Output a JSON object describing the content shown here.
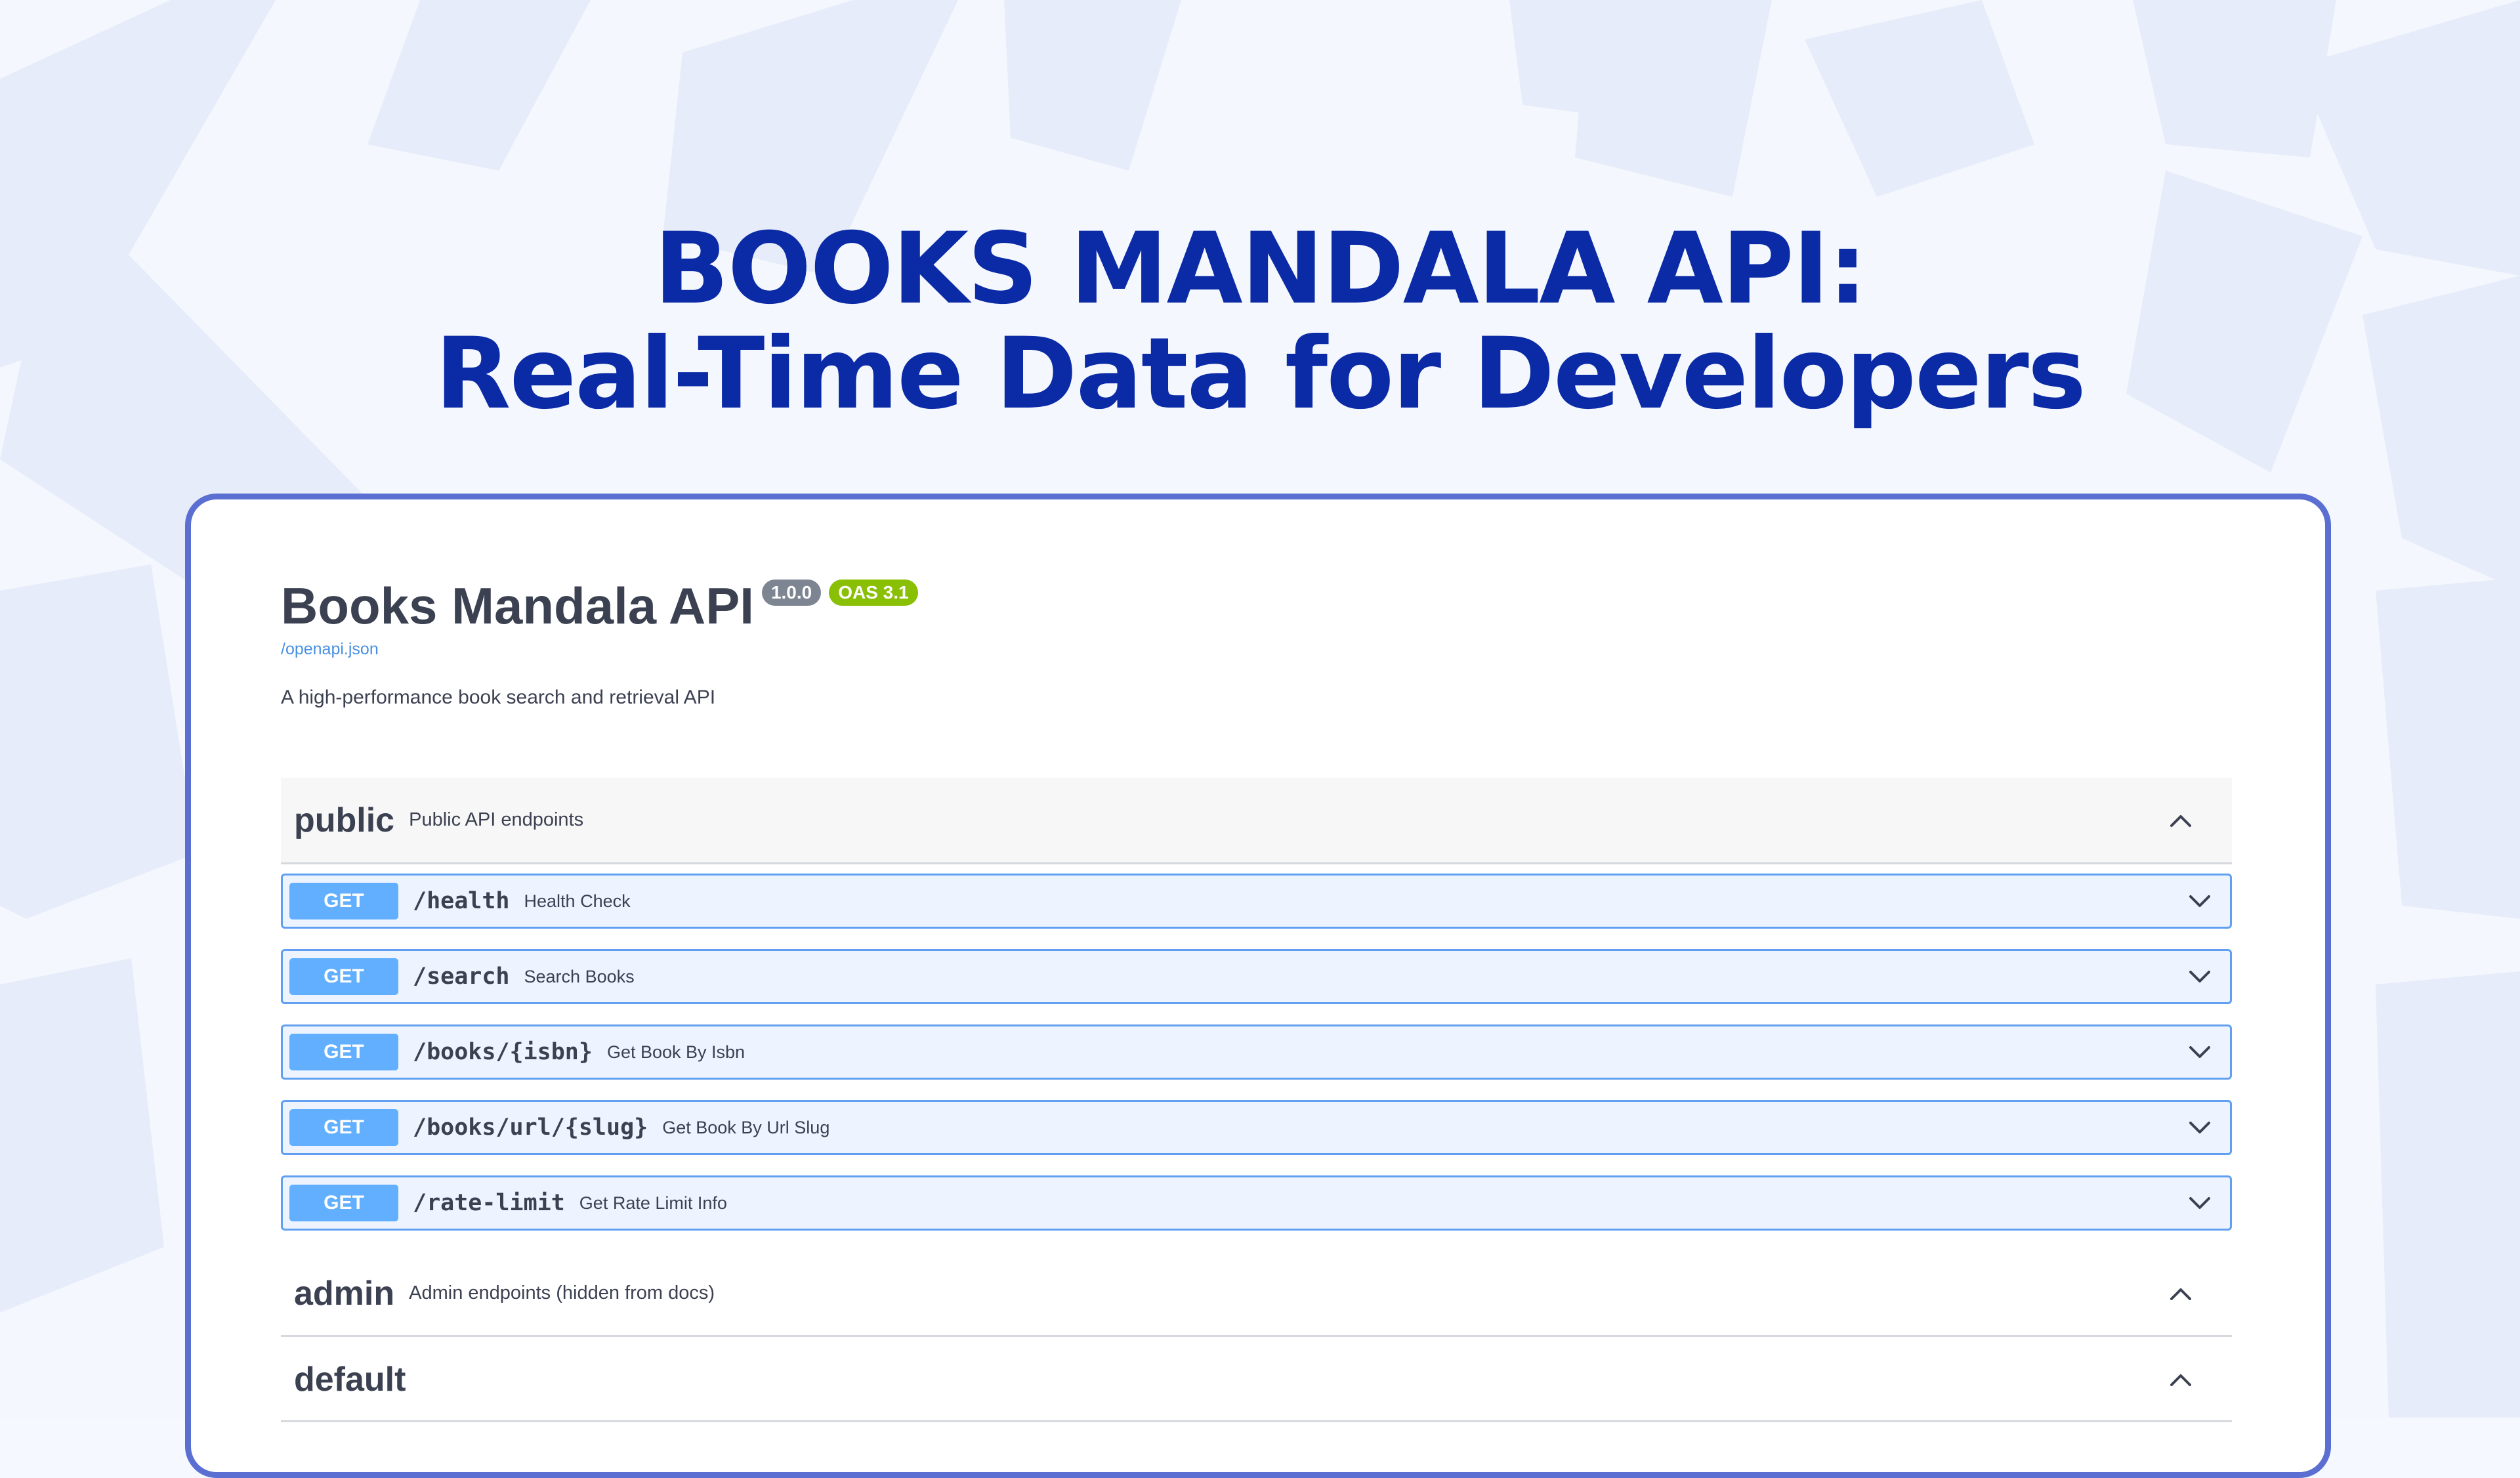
{
  "headline": {
    "line1": "BOOKS MANDALA API:",
    "line2": "Real-Time Data for Developers"
  },
  "colors": {
    "headline": "#0a2aa6",
    "card_border": "#5a6fd1",
    "get_method": "#61affe",
    "op_border": "#61a0f0",
    "version_badge": "#7d8492",
    "oas_badge": "#89bf04"
  },
  "api": {
    "title": "Books Mandala API",
    "version_badge": "1.0.0",
    "oas_badge": "OAS 3.1",
    "spec_link": "/openapi.json",
    "description": "A high-performance book search and retrieval API"
  },
  "sections": {
    "public": {
      "name": "public",
      "description": "Public API endpoints",
      "chevron": "chevron-up-icon"
    },
    "admin": {
      "name": "admin",
      "description": "Admin endpoints (hidden from docs)",
      "chevron": "chevron-up-icon"
    },
    "default": {
      "name": "default",
      "chevron": "chevron-up-icon"
    }
  },
  "operations": [
    {
      "method": "GET",
      "path": "/health",
      "summary": "Health Check",
      "chevron": "chevron-down-icon"
    },
    {
      "method": "GET",
      "path": "/search",
      "summary": "Search Books",
      "chevron": "chevron-down-icon"
    },
    {
      "method": "GET",
      "path": "/books/{isbn}",
      "summary": "Get Book By Isbn",
      "chevron": "chevron-down-icon"
    },
    {
      "method": "GET",
      "path": "/books/url/{slug}",
      "summary": "Get Book By Url Slug",
      "chevron": "chevron-down-icon"
    },
    {
      "method": "GET",
      "path": "/rate-limit",
      "summary": "Get Rate Limit Info",
      "chevron": "chevron-down-icon"
    }
  ]
}
